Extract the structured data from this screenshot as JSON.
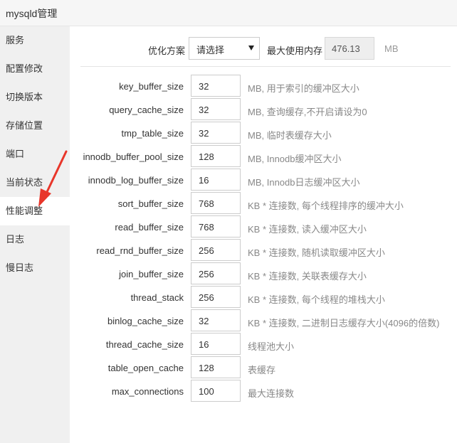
{
  "window": {
    "title": "mysqld管理"
  },
  "sidebar": {
    "items": [
      {
        "label": "服务"
      },
      {
        "label": "配置修改"
      },
      {
        "label": "切换版本"
      },
      {
        "label": "存储位置"
      },
      {
        "label": "端口"
      },
      {
        "label": "当前状态"
      },
      {
        "label": "性能调整",
        "active": true
      },
      {
        "label": "日志"
      },
      {
        "label": "慢日志"
      }
    ]
  },
  "optimize": {
    "scheme_label": "优化方案",
    "scheme_value": "请选择",
    "maxmem_label": "最大使用内存",
    "maxmem_value": "476.13",
    "maxmem_unit": "MB"
  },
  "params": [
    {
      "name": "key_buffer_size",
      "value": "32",
      "desc": "MB, 用于索引的缓冲区大小"
    },
    {
      "name": "query_cache_size",
      "value": "32",
      "desc": "MB, 查询缓存,不开启请设为0"
    },
    {
      "name": "tmp_table_size",
      "value": "32",
      "desc": "MB, 临时表缓存大小"
    },
    {
      "name": "innodb_buffer_pool_size",
      "value": "128",
      "desc": "MB, Innodb缓冲区大小"
    },
    {
      "name": "innodb_log_buffer_size",
      "value": "16",
      "desc": "MB, Innodb日志缓冲区大小"
    },
    {
      "name": "sort_buffer_size",
      "value": "768",
      "desc": "KB * 连接数, 每个线程排序的缓冲大小"
    },
    {
      "name": "read_buffer_size",
      "value": "768",
      "desc": "KB * 连接数, 读入缓冲区大小"
    },
    {
      "name": "read_rnd_buffer_size",
      "value": "256",
      "desc": "KB * 连接数, 随机读取缓冲区大小"
    },
    {
      "name": "join_buffer_size",
      "value": "256",
      "desc": "KB * 连接数, 关联表缓存大小"
    },
    {
      "name": "thread_stack",
      "value": "256",
      "desc": "KB * 连接数, 每个线程的堆栈大小"
    },
    {
      "name": "binlog_cache_size",
      "value": "32",
      "desc": "KB * 连接数, 二进制日志缓存大小(4096的倍数)"
    },
    {
      "name": "thread_cache_size",
      "value": "16",
      "desc": "线程池大小"
    },
    {
      "name": "table_open_cache",
      "value": "128",
      "desc": "表缓存"
    },
    {
      "name": "max_connections",
      "value": "100",
      "desc": "最大连接数"
    }
  ],
  "annotation": {
    "color": "#e8362a"
  }
}
